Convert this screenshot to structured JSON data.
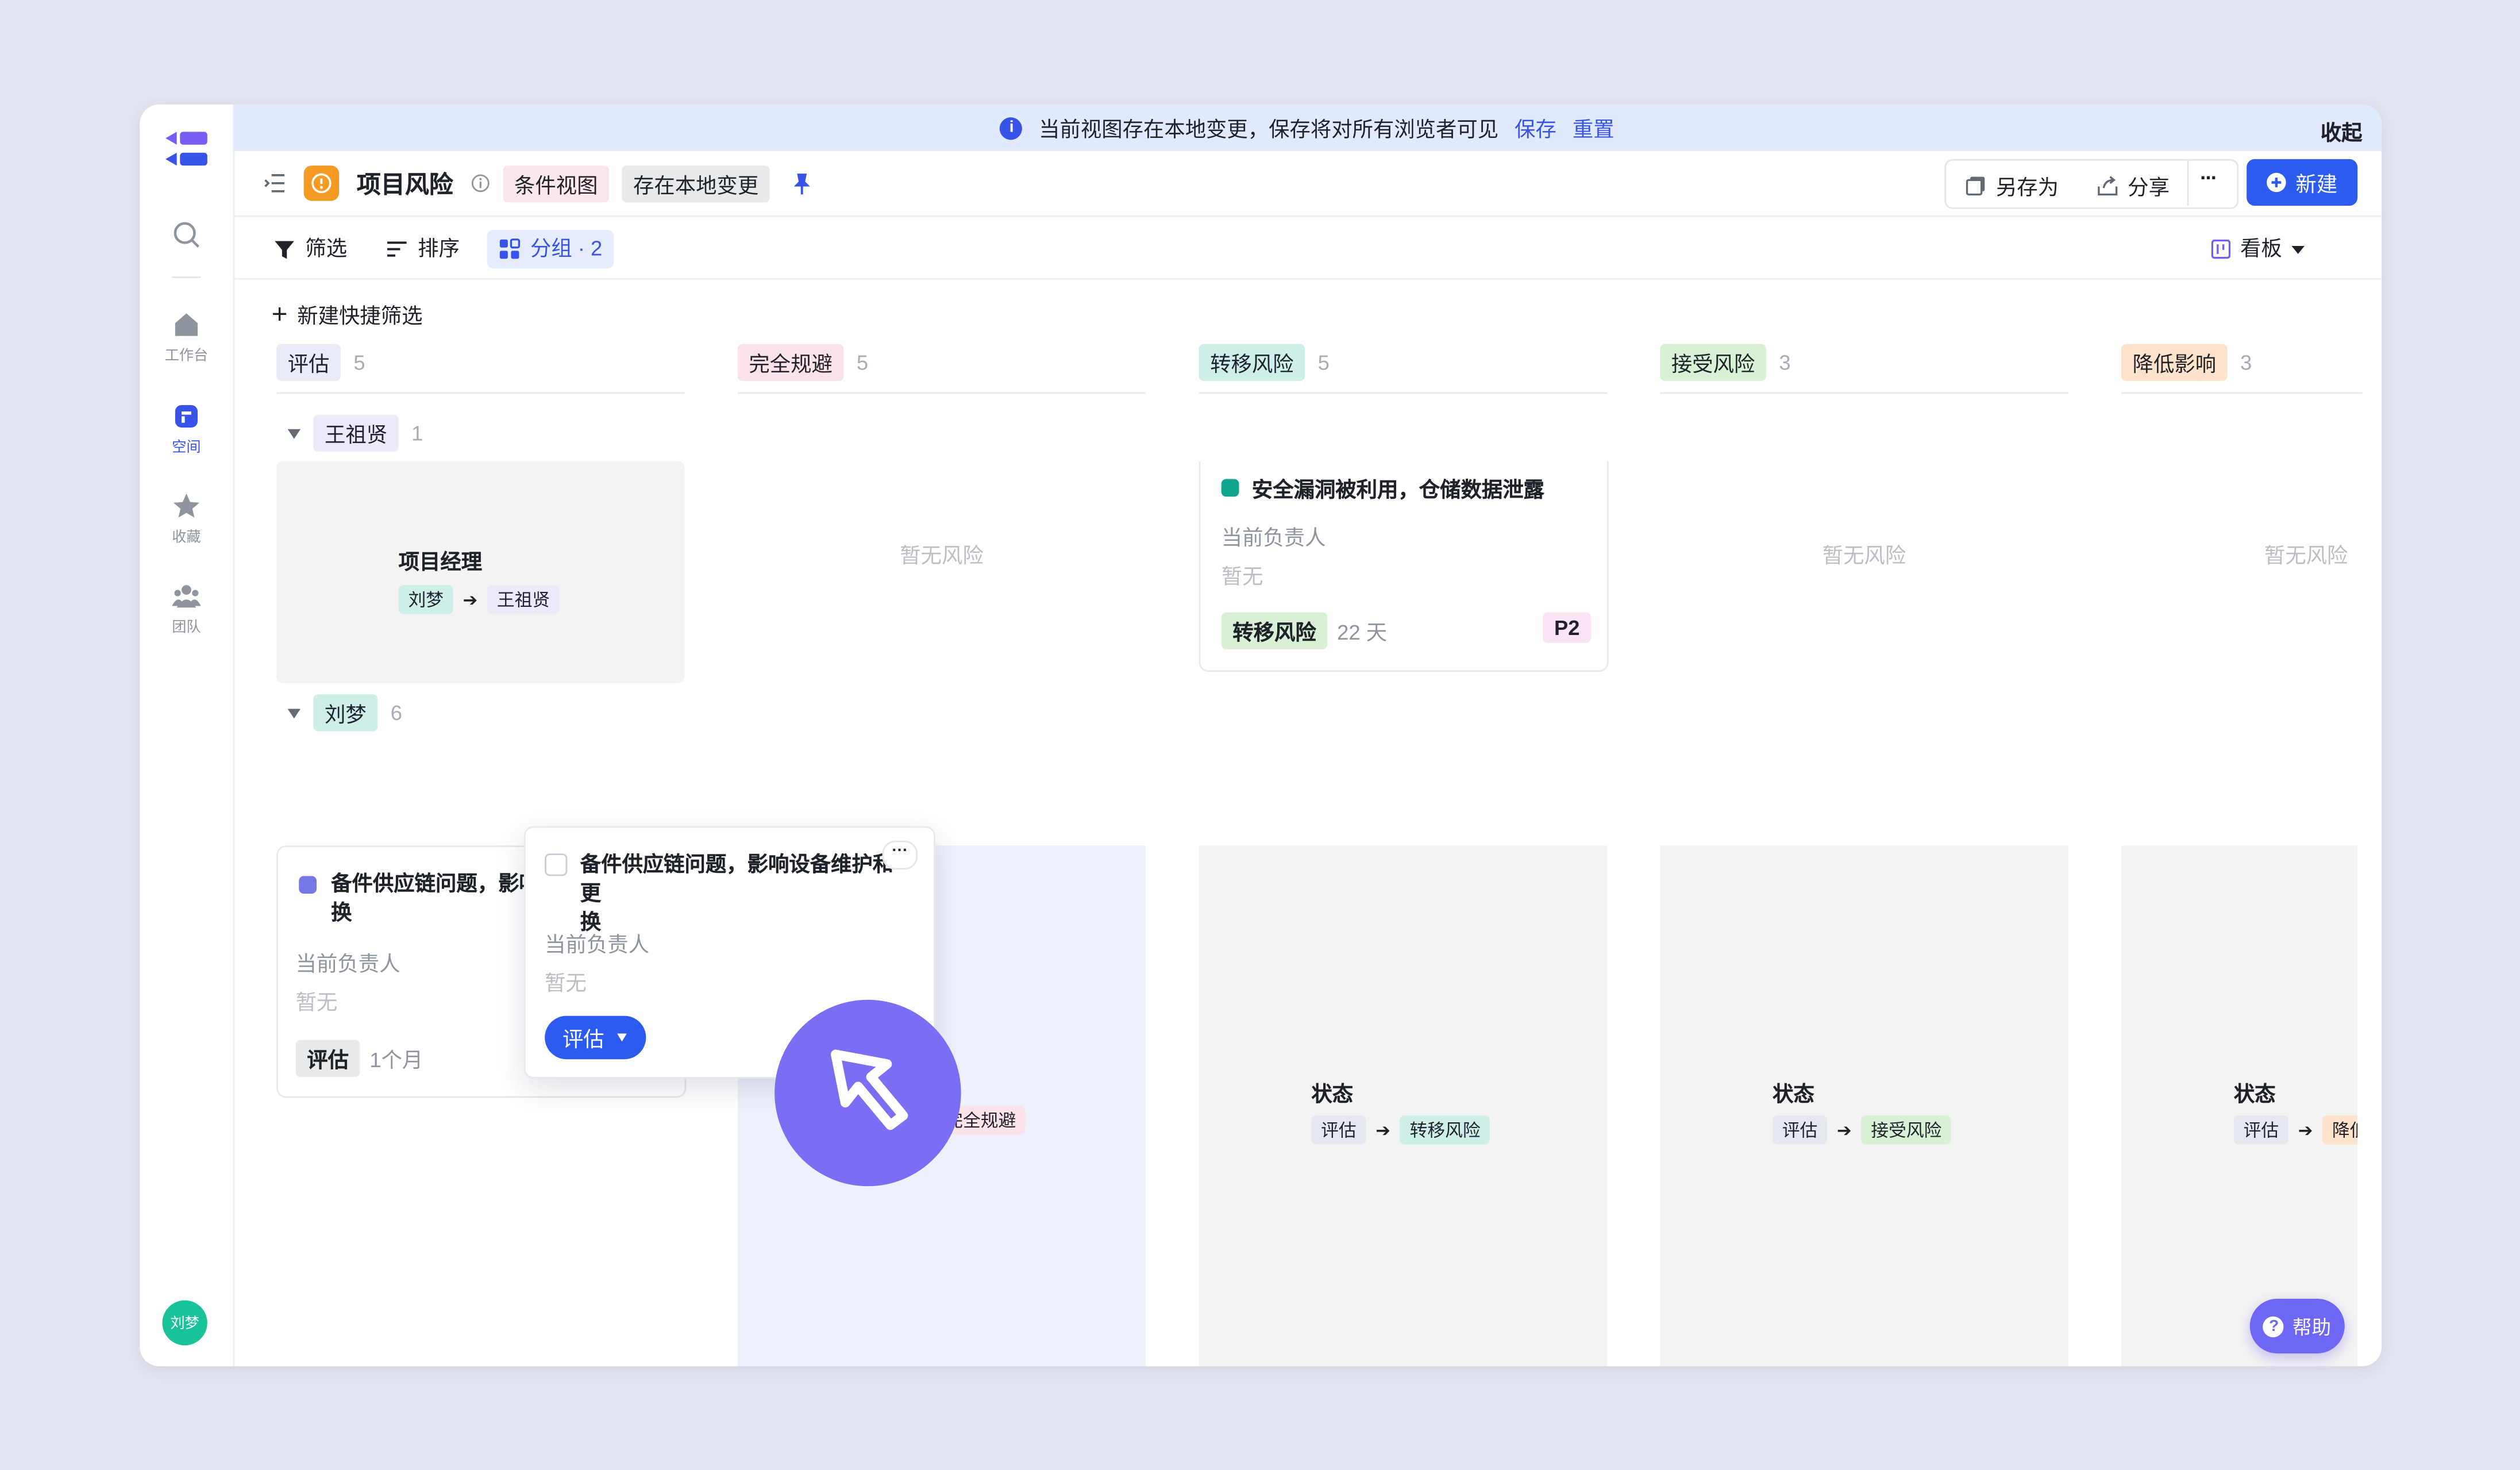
{
  "notice": {
    "text": "当前视图存在本地变更，保存将对所有浏览者可见",
    "save": "保存",
    "reset": "重置",
    "collapse": "收起"
  },
  "sidebar": {
    "items": [
      {
        "icon": "search-icon",
        "label": ""
      },
      {
        "icon": "home-icon",
        "label": "工作台"
      },
      {
        "icon": "space-icon",
        "label": "空间"
      },
      {
        "icon": "star-icon",
        "label": "收藏"
      },
      {
        "icon": "team-icon",
        "label": "团队"
      }
    ],
    "avatar": "刘梦"
  },
  "header": {
    "title": "项目风险",
    "tag_view": "条件视图",
    "tag_local": "存在本地变更",
    "save_as": "另存为",
    "share": "分享",
    "more": "···",
    "new": "新建"
  },
  "toolbar": {
    "filter": "筛选",
    "sort": "排序",
    "group": "分组 · 2",
    "view": "看板"
  },
  "quick_filter": "新建快捷筛选",
  "columns": [
    {
      "label": "评估",
      "count": "5",
      "color": "#e8ecf6"
    },
    {
      "label": "完全规避",
      "count": "5",
      "color": "#fbe1ea"
    },
    {
      "label": "转移风险",
      "count": "5",
      "color": "#cdeee9"
    },
    {
      "label": "接受风险",
      "count": "3",
      "color": "#d8f1d5"
    },
    {
      "label": "降低影响",
      "count": "3",
      "color": "#fde2cc"
    }
  ],
  "groups": [
    {
      "name": "王祖贤",
      "count": "1"
    },
    {
      "name": "刘梦",
      "count": "6"
    }
  ],
  "row1": {
    "transition": {
      "title": "项目经理",
      "from": "刘梦",
      "to": "王祖贤"
    },
    "empty": "暂无风险",
    "card": {
      "title": "安全漏洞被利用，仓储数据泄露",
      "owner_label": "当前负责人",
      "owner": "暂无",
      "status": "转移风险",
      "duration": "22 天",
      "priority": "P2"
    }
  },
  "row2": {
    "card": {
      "title_l1": "备件供应链问题，影响设备维护和更",
      "title_l2": "换",
      "owner_label": "当前负责人",
      "owner": "暂无",
      "status": "评估",
      "duration": "1个月"
    },
    "drag": {
      "title_l1": "备件供应链问题，影响设备维护和更",
      "title_l2": "换",
      "owner_label": "当前负责人",
      "owner": "暂无",
      "status": "评估"
    },
    "transitions": [
      {
        "title": "状态",
        "from": "评估",
        "to": "完全规避"
      },
      {
        "title": "状态",
        "from": "评估",
        "to": "转移风险"
      },
      {
        "title": "状态",
        "from": "评估",
        "to": "接受风险"
      },
      {
        "title": "状态",
        "from": "评估",
        "to": "降低影响"
      }
    ]
  },
  "help": "帮助"
}
